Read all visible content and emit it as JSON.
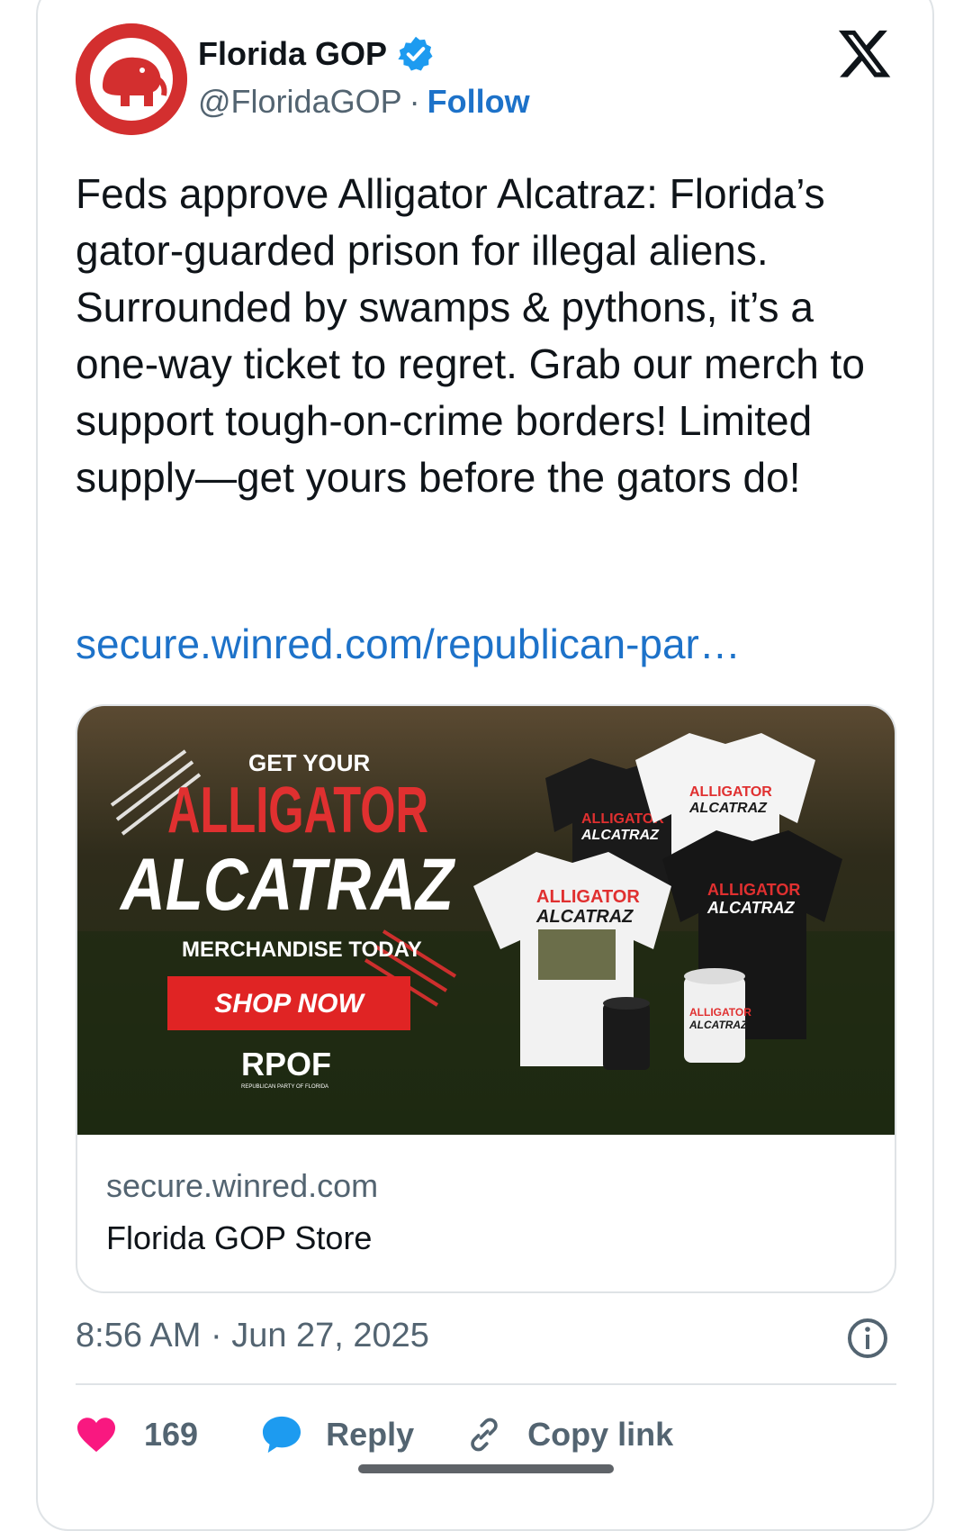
{
  "author": {
    "name": "Florida GOP",
    "handle": "@FloridaGOP",
    "separator": "·",
    "follow_label": "Follow",
    "verified_icon": "verified-badge-icon",
    "verified_color": "#1d9bf0"
  },
  "tweet": {
    "text": "Feds approve Alligator Alcatraz: Florida’s gator-guarded prison for illegal aliens. Surrounded by swamps & pythons, it’s a one-way ticket to regret. Grab our merch to support tough-on-crime borders! Limited supply—get yours before the gators do!",
    "link_text": "secure.winred.com/republican-par…"
  },
  "link_card": {
    "banner": {
      "headline_top": "GET YOUR",
      "headline_main": "ALLIGATOR",
      "headline_script": "ALCATRAZ",
      "subline": "MERCHANDISE TODAY",
      "cta": "SHOP NOW",
      "logo": "RPOF",
      "logo_sub": "REPUBLICAN PARTY OF FLORIDA",
      "shirt_text_1": "ALLIGATOR",
      "shirt_text_2": "ALCATRAZ"
    },
    "domain": "secure.winred.com",
    "title": "Florida GOP Store"
  },
  "meta": {
    "timestamp": "8:56 AM · Jun 27, 2025"
  },
  "actions": {
    "like_count": "169",
    "reply_label": "Reply",
    "copy_link_label": "Copy link"
  },
  "colors": {
    "link_blue": "#1d72c9",
    "like_pink": "#f91880",
    "reply_blue": "#1d9bf0",
    "brand_red": "#d32f2f",
    "muted_text": "#536471"
  }
}
